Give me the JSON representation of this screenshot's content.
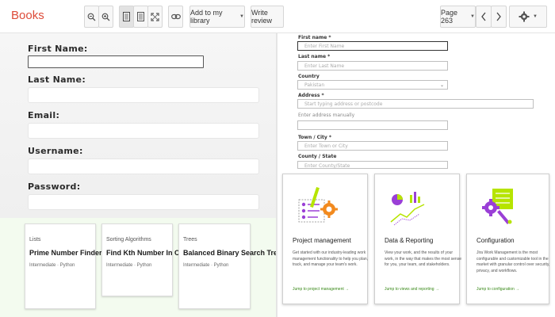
{
  "toolbar": {
    "brand": "Books",
    "add_to_library": "Add to my library",
    "write_review": "Write review",
    "page_label": "Page 263",
    "icons": [
      "zoom-out-icon",
      "zoom-in-icon",
      "single-page-icon",
      "text-view-icon",
      "fullscreen-icon",
      "link-icon",
      "prev-page-icon",
      "next-page-icon",
      "gear-icon"
    ]
  },
  "form": {
    "first_name_label": "First Name:",
    "last_name_label": "Last Name:",
    "email_label": "Email:",
    "username_label": "Username:",
    "password_label": "Password:"
  },
  "problem_cards": [
    {
      "category": "Lists",
      "title": "Prime Number Finder",
      "meta": "Intermediate · Python"
    },
    {
      "category": "Sorting Algorithms",
      "title": "Find Kth Number In Order",
      "meta": "Intermediate · Python"
    },
    {
      "category": "Trees",
      "title": "Balanced Binary Search Tree",
      "meta": "Intermediate · Python"
    }
  ],
  "address_form": {
    "first_name_label": "First name *",
    "first_name_placeholder": "Enter First Name",
    "last_name_label": "Last name *",
    "last_name_placeholder": "Enter Last Name",
    "country_label": "Country",
    "country_value": "Pakistan",
    "address_label": "Address *",
    "address_placeholder": "Start typing address or postcode",
    "address_manual": "Enter address manually",
    "town_label": "Town / City *",
    "town_placeholder": "Enter Town or City",
    "county_label": "County / State",
    "county_placeholder": "Enter County/State"
  },
  "feature_cards": [
    {
      "title": "Project management",
      "description": "Get started with our industry-leading work management functionality to help you plan, track, and manage your team's work.",
      "link": "Jump to project management →"
    },
    {
      "title": "Data & Reporting",
      "description": "View your work, and the results of your work, in the way that makes the most sense for you, your team, and stakeholders.",
      "link": "Jump to views and reporting →"
    },
    {
      "title": "Configuration",
      "description": "Jira Work Management is the most configurable and customizable tool in the market with granular control over security, privacy, and workflows.",
      "link": "Jump to configuration →"
    }
  ],
  "colors": {
    "brand": "#dd4b39",
    "link_green": "#3a8a1a",
    "card_panel_bg": "#f3fbef",
    "illustration_lime": "#b6e400",
    "illustration_purple": "#9a3fd6",
    "illustration_orange": "#f28a1e"
  }
}
